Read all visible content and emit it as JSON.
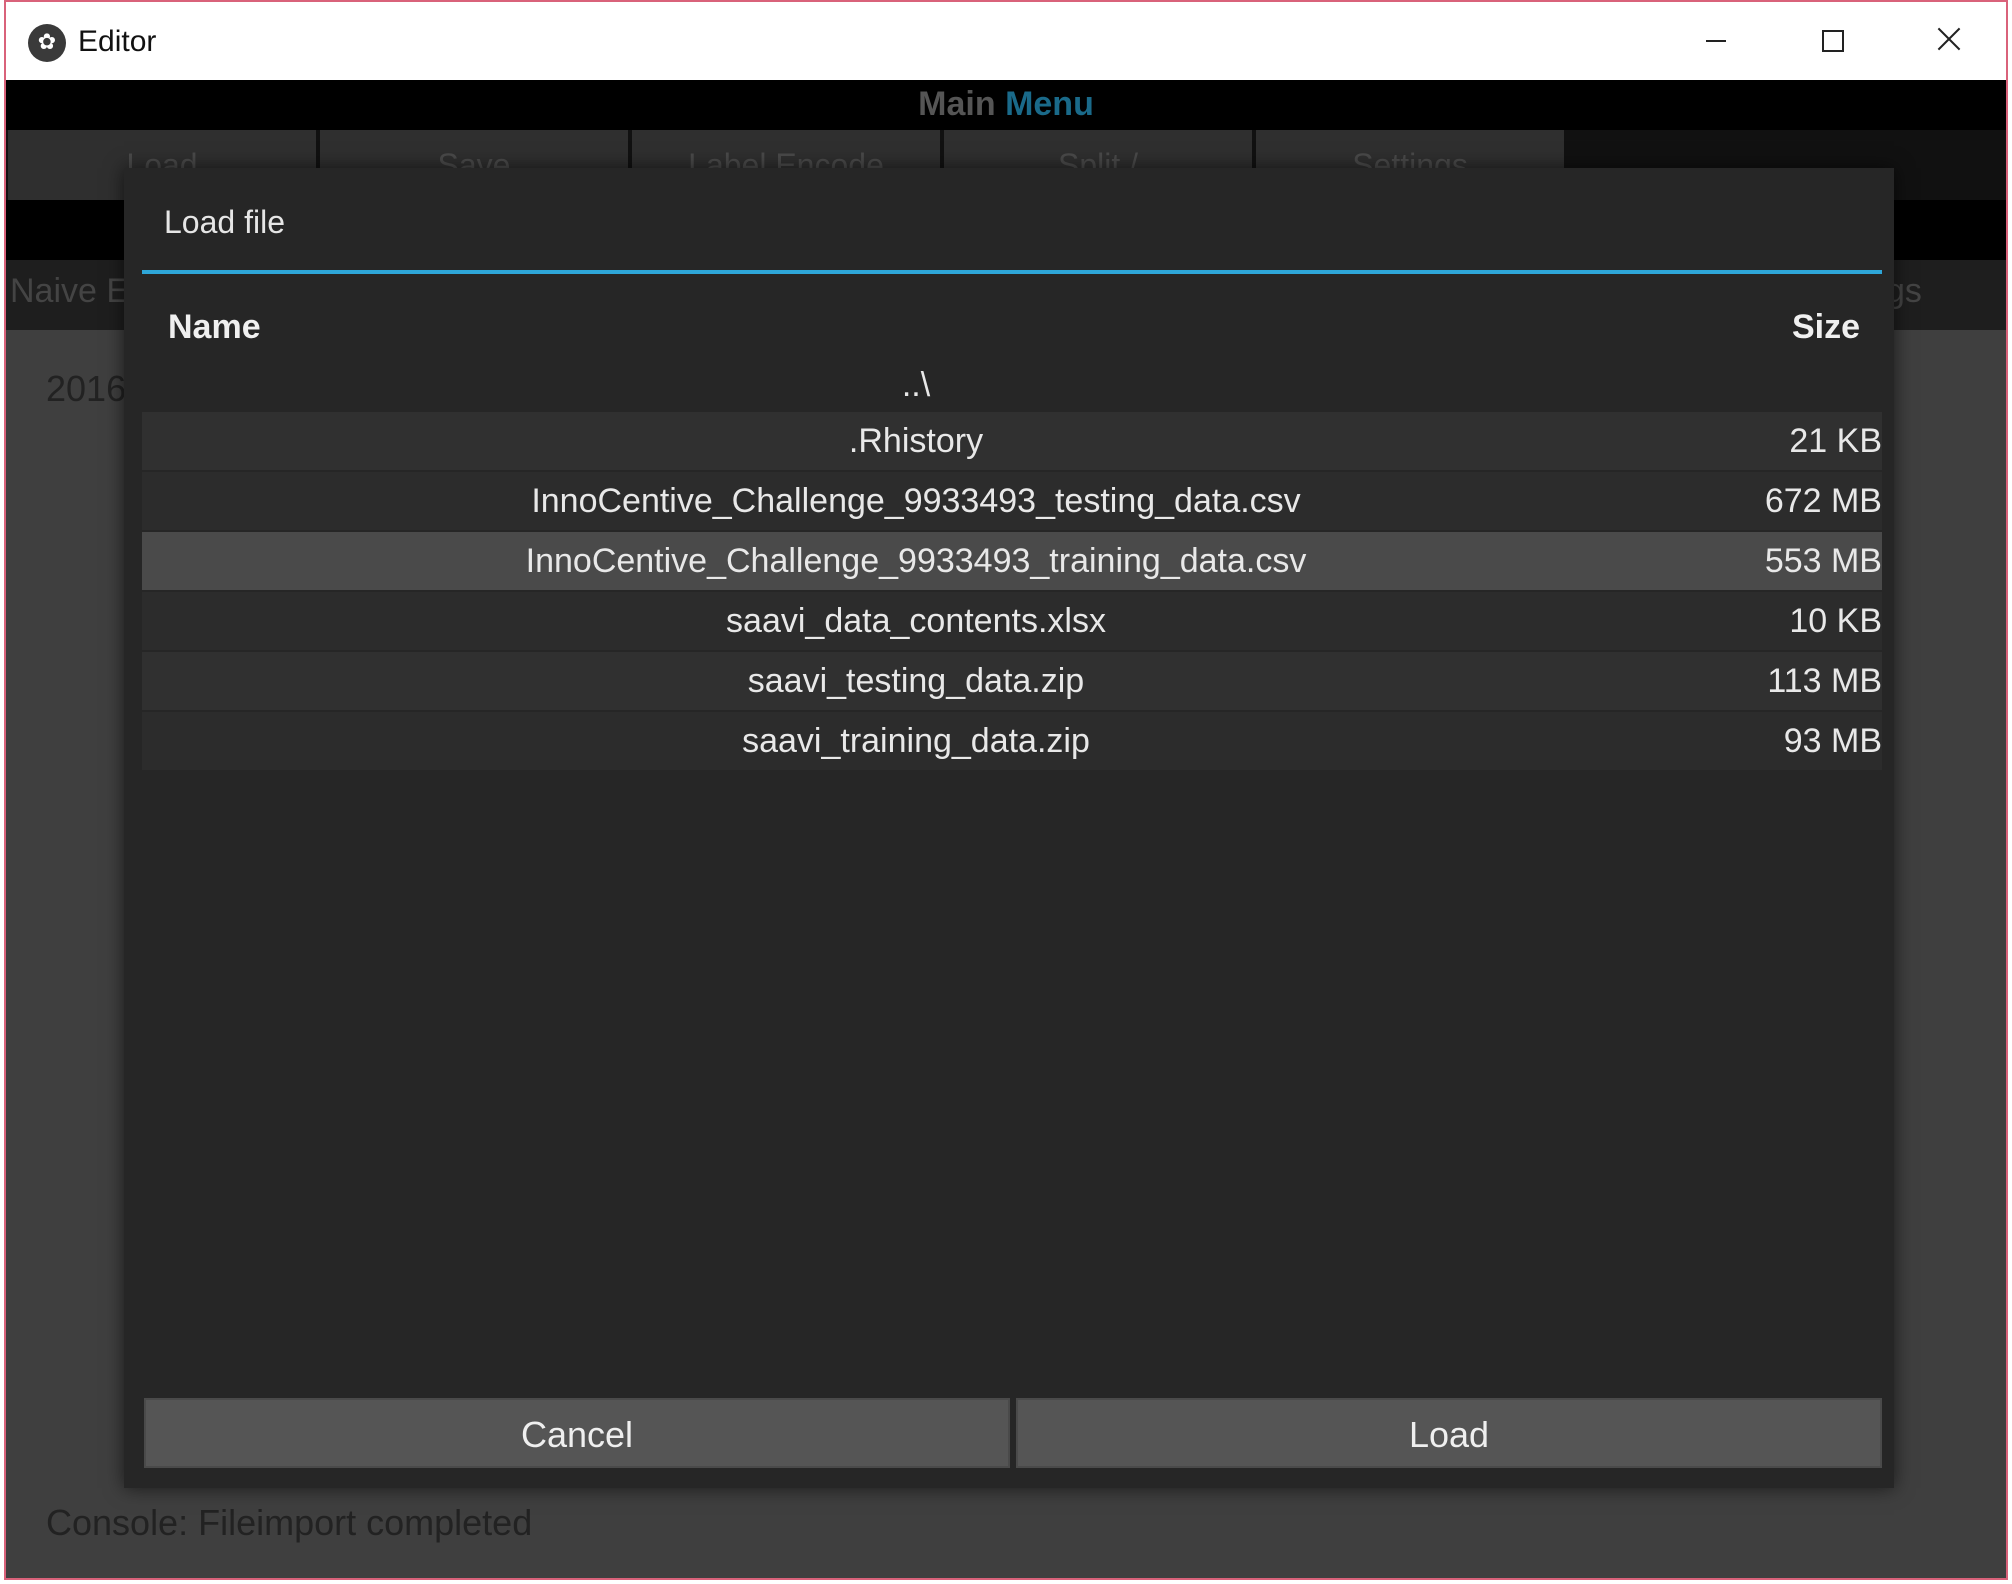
{
  "window": {
    "title": "Editor"
  },
  "app": {
    "menu_title_main": "Main",
    "menu_title_accent": "Menu",
    "tabs": [
      "Load",
      "Save",
      "Label Encode",
      "Split / CrossValidation",
      "Settings"
    ],
    "second_row_left": "Naive E",
    "second_row_right": "gs",
    "year_text": "2016",
    "console_text": "Console: Fileimport completed"
  },
  "dialog": {
    "title": "Load file",
    "columns": {
      "name": "Name",
      "size": "Size"
    },
    "parent_dir": "..\\",
    "files": [
      {
        "name": ".Rhistory",
        "size": "21 KB"
      },
      {
        "name": "InnoCentive_Challenge_9933493_testing_data.csv",
        "size": "672 MB"
      },
      {
        "name": "InnoCentive_Challenge_9933493_training_data.csv",
        "size": "553 MB",
        "selected": true
      },
      {
        "name": "saavi_data_contents.xlsx",
        "size": "10 KB"
      },
      {
        "name": "saavi_testing_data.zip",
        "size": "113 MB"
      },
      {
        "name": "saavi_training_data.zip",
        "size": "93 MB"
      }
    ],
    "cancel_label": "Cancel",
    "load_label": "Load"
  },
  "colors": {
    "accent": "#2ea6d8",
    "window_border": "#d9627a"
  }
}
